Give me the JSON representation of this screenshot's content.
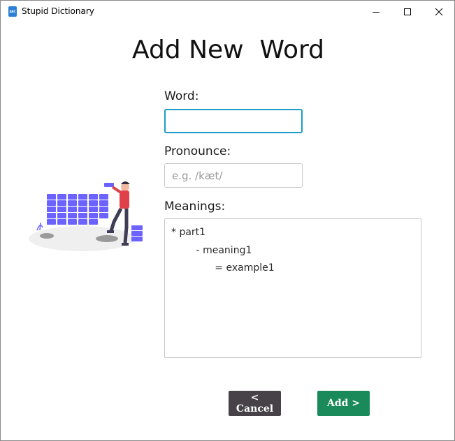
{
  "window": {
    "title": "Stupid Dictionary",
    "icon_label": "ABC"
  },
  "form": {
    "heading": "Add New  Word",
    "word_label": "Word:",
    "word_value": "",
    "pronounce_label": "Pronounce:",
    "pronounce_placeholder": "e.g. /kæt/",
    "meanings_label": "Meanings:",
    "meanings_value": "* part1\n        - meaning1\n              = example1"
  },
  "buttons": {
    "cancel_label": "< Cancel",
    "add_label": "Add >"
  },
  "colors": {
    "focus_border": "#1c9cc9",
    "cancel_bg": "#464247",
    "add_bg": "#1b8a5a",
    "illustration_accent": "#6c63ff"
  }
}
